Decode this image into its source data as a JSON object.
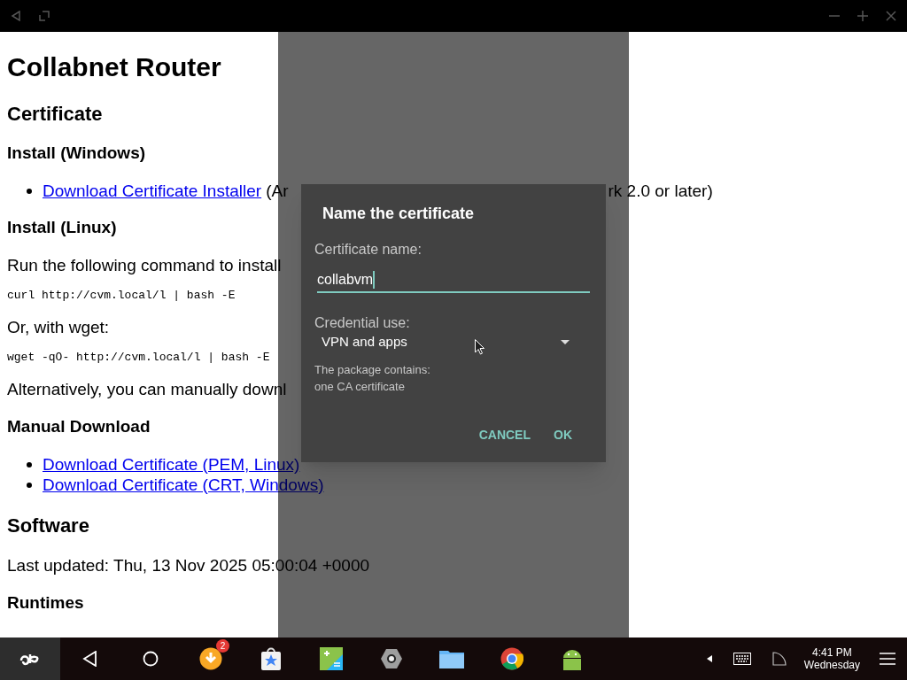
{
  "page": {
    "blocks": [
      {
        "kind": "h1",
        "text": "Collabnet Router"
      },
      {
        "kind": "h2",
        "text": "Certificate"
      },
      {
        "kind": "h3",
        "text": "Install (Windows)"
      },
      {
        "kind": "li",
        "link": "Download Certificate Installer",
        "tail": "(Ar",
        "tail_after_dialog": "rk 2.0 or later)"
      },
      {
        "kind": "h3",
        "text": "Install (Linux)"
      },
      {
        "kind": "p",
        "text": "Run the following command to install"
      },
      {
        "kind": "code",
        "text": "curl http://cvm.local/l | bash -E"
      },
      {
        "kind": "p",
        "text": "Or, with wget:"
      },
      {
        "kind": "code",
        "text": "wget -qO- http://cvm.local/l | bash -E"
      },
      {
        "kind": "p",
        "text": "Alternatively, you can manually downl"
      },
      {
        "kind": "h3",
        "text": "Manual Download"
      },
      {
        "kind": "li",
        "link": "Download Certificate (PEM, Linux)"
      },
      {
        "kind": "li",
        "link": "Download Certificate (CRT, Windows)"
      },
      {
        "kind": "h2",
        "text": "Software"
      },
      {
        "kind": "p",
        "text": "Last updated: Thu, 13 Nov 2025 05:00:04 +0000"
      },
      {
        "kind": "h3",
        "text": "Runtimes"
      }
    ]
  },
  "dialog": {
    "title": "Name the certificate",
    "name_label": "Certificate name:",
    "name_value": "collabvm",
    "use_label": "Credential use:",
    "use_value": "VPN and apps",
    "info": [
      "The package contains:",
      "one CA certificate"
    ],
    "buttons": [
      "CANCEL",
      "OK"
    ]
  },
  "taskbar": {
    "badge": "2",
    "time": "4:41 PM",
    "day": "Wednesday"
  }
}
